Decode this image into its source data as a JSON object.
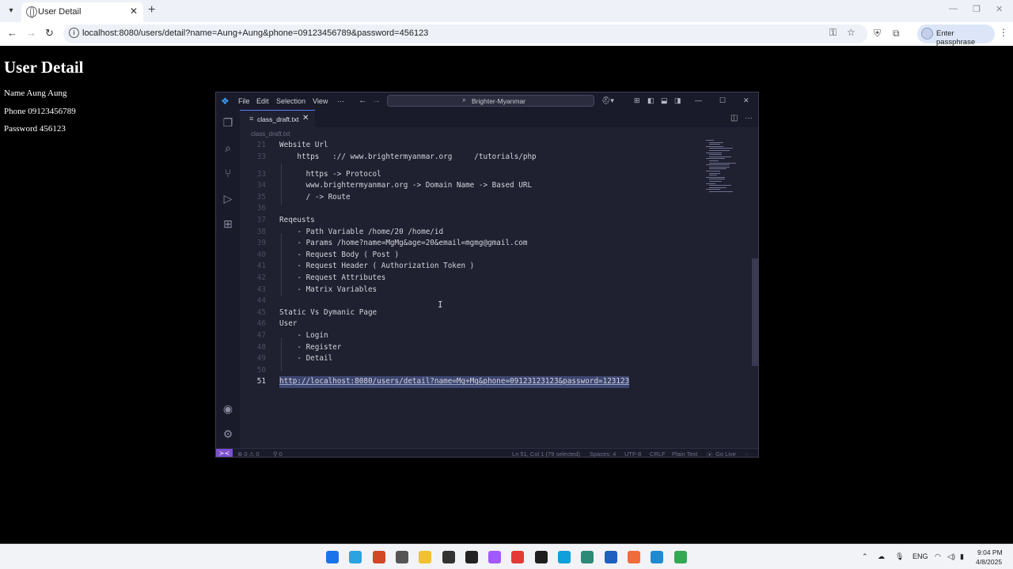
{
  "browser": {
    "tab_title": "User Detail",
    "url": "localhost:8080/users/detail?name=Aung+Aung&phone=09123456789&password=456123",
    "passphrase_label": "Enter passphrase"
  },
  "page": {
    "heading": "User Detail",
    "name_line": "Name Aung Aung",
    "phone_line": "Phone 09123456789",
    "password_line": "Password 456123"
  },
  "vscode": {
    "menu": [
      "File",
      "Edit",
      "Selection",
      "View"
    ],
    "search_label": "Brighter-Myanmar",
    "tab_label": "class_draft.txt",
    "breadcrumb": "class_draft.txt",
    "lines": [
      {
        "n": "21",
        "t": "Website Url"
      },
      {
        "n": "33",
        "t": "    https   :// www.brightermyanmar.org     /tutorials/php"
      },
      {
        "n": "33",
        "t": "      https -> Protocol"
      },
      {
        "n": "34",
        "t": "      www.brightermyanmar.org -> Domain Name -> Based URL"
      },
      {
        "n": "35",
        "t": "      / -> Route"
      },
      {
        "n": "36",
        "t": ""
      },
      {
        "n": "37",
        "t": "Reqeusts"
      },
      {
        "n": "38",
        "t": "    - Path Variable /home/20 /home/id"
      },
      {
        "n": "39",
        "t": "    - Params /home?name=MgMg&age=20&email=mgmg@gmail.com"
      },
      {
        "n": "40",
        "t": "    - Request Body ( Post )"
      },
      {
        "n": "41",
        "t": "    - Request Header ( Authorization Token )"
      },
      {
        "n": "42",
        "t": "    - Request Attributes"
      },
      {
        "n": "43",
        "t": "    - Matrix Variables"
      },
      {
        "n": "44",
        "t": ""
      },
      {
        "n": "45",
        "t": "Static Vs Dymanic Page"
      },
      {
        "n": "46",
        "t": "User"
      },
      {
        "n": "47",
        "t": "    - Login"
      },
      {
        "n": "48",
        "t": "    - Register"
      },
      {
        "n": "49",
        "t": "    - Detail"
      },
      {
        "n": "50",
        "t": ""
      },
      {
        "n": "51",
        "t": "http://localhost:8080/users/detail?name=Mg+Mg&phone=09123123123&password=123123"
      }
    ],
    "status": {
      "problems": "⊗ 0 ⚠ 0",
      "ports": "⚲ 0",
      "position": "Ln 51, Col 1 (79 selected)",
      "spaces": "Spaces: 4",
      "encoding": "UTF-8",
      "eol": "CRLF",
      "language": "Plain Text",
      "golive": "Go Live"
    }
  },
  "taskbar": {
    "lang": "ENG",
    "time": "9:04 PM",
    "date": "4/8/2025",
    "apps": [
      {
        "name": "windows-start",
        "color": "#1a73e8"
      },
      {
        "name": "telegram",
        "color": "#2aa3e0"
      },
      {
        "name": "powerpoint",
        "color": "#d24726"
      },
      {
        "name": "chrome-alt",
        "color": "#555555"
      },
      {
        "name": "file-explorer",
        "color": "#f2c12e"
      },
      {
        "name": "notepad",
        "color": "#333333"
      },
      {
        "name": "capcut",
        "color": "#222222"
      },
      {
        "name": "figma",
        "color": "#a259ff"
      },
      {
        "name": "anydesk",
        "color": "#e53935"
      },
      {
        "name": "app-dark",
        "color": "#1e1e1e"
      },
      {
        "name": "edge",
        "color": "#0f9fda"
      },
      {
        "name": "vscode-insiders",
        "color": "#2d8a76"
      },
      {
        "name": "sourcetree",
        "color": "#1f5fbf"
      },
      {
        "name": "postman",
        "color": "#f26b3a"
      },
      {
        "name": "vscode",
        "color": "#1f8ad2"
      },
      {
        "name": "chrome",
        "color": "#34a853"
      }
    ]
  },
  "colors": {
    "vscode_bg": "#1f2030",
    "accent": "#7b4fcf",
    "selection": "#3d4670"
  }
}
